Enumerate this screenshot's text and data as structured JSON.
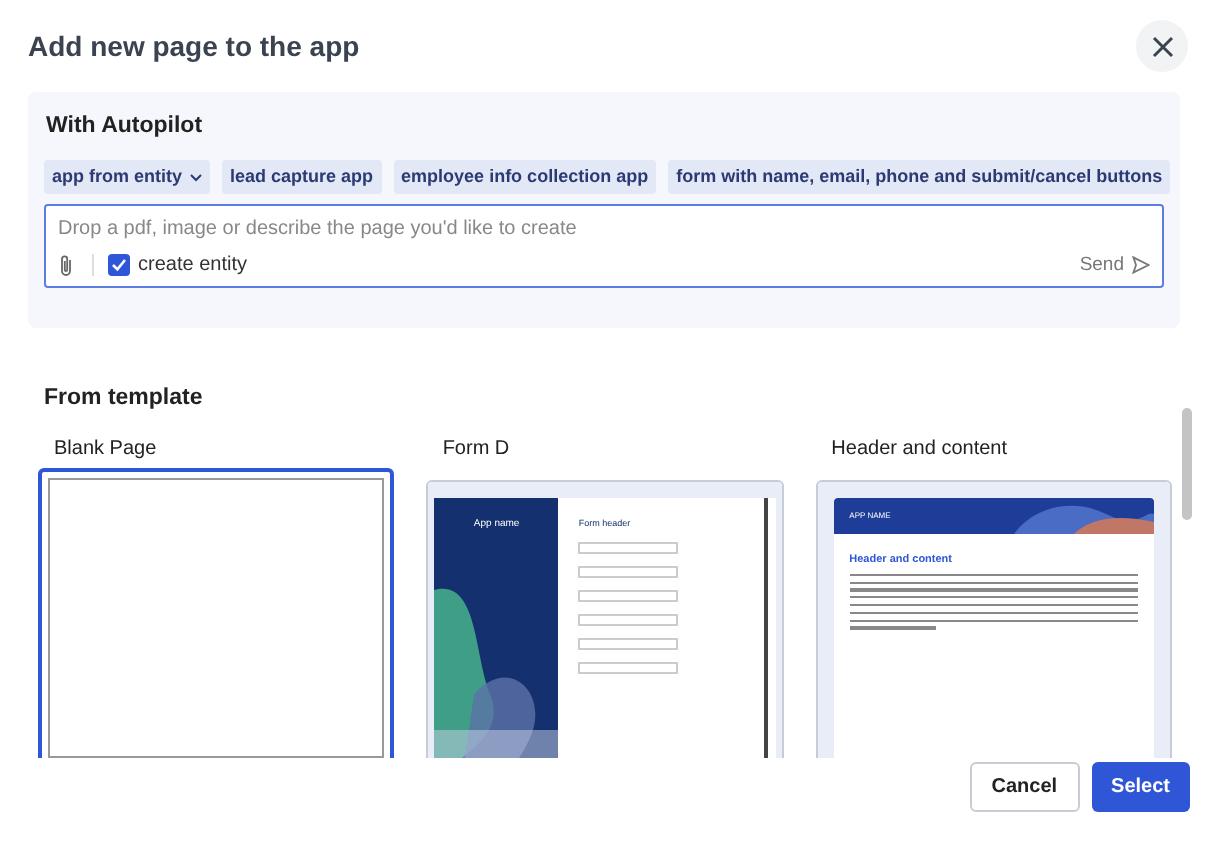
{
  "dialog": {
    "title": "Add new page to the app"
  },
  "autopilot": {
    "heading": "With Autopilot",
    "suggestions": [
      {
        "label": "app from entity",
        "dropdown": true
      },
      {
        "label": "lead capture app",
        "dropdown": false
      },
      {
        "label": "employee info collection app",
        "dropdown": false
      },
      {
        "label": "form with name, email, phone and submit/cancel buttons",
        "dropdown": false
      }
    ],
    "prompt": {
      "placeholder": "Drop a pdf, image or describe the page you'd like to create"
    },
    "create_entity": {
      "label": "create entity",
      "checked": true
    },
    "send": "Send"
  },
  "templates": {
    "heading": "From template",
    "items": [
      {
        "name": "Blank Page",
        "kind": "blank",
        "selected": true
      },
      {
        "name": "Form D",
        "kind": "form",
        "selected": false,
        "app_name": "App name",
        "form_header": "Form header"
      },
      {
        "name": "Header and content",
        "kind": "header",
        "selected": false,
        "app_name": "APP NAME",
        "content_title": "Header and content"
      }
    ]
  },
  "buttons": [
    {
      "label": "Cancel",
      "kind": "secondary"
    },
    {
      "label": "Select",
      "kind": "primary"
    }
  ]
}
